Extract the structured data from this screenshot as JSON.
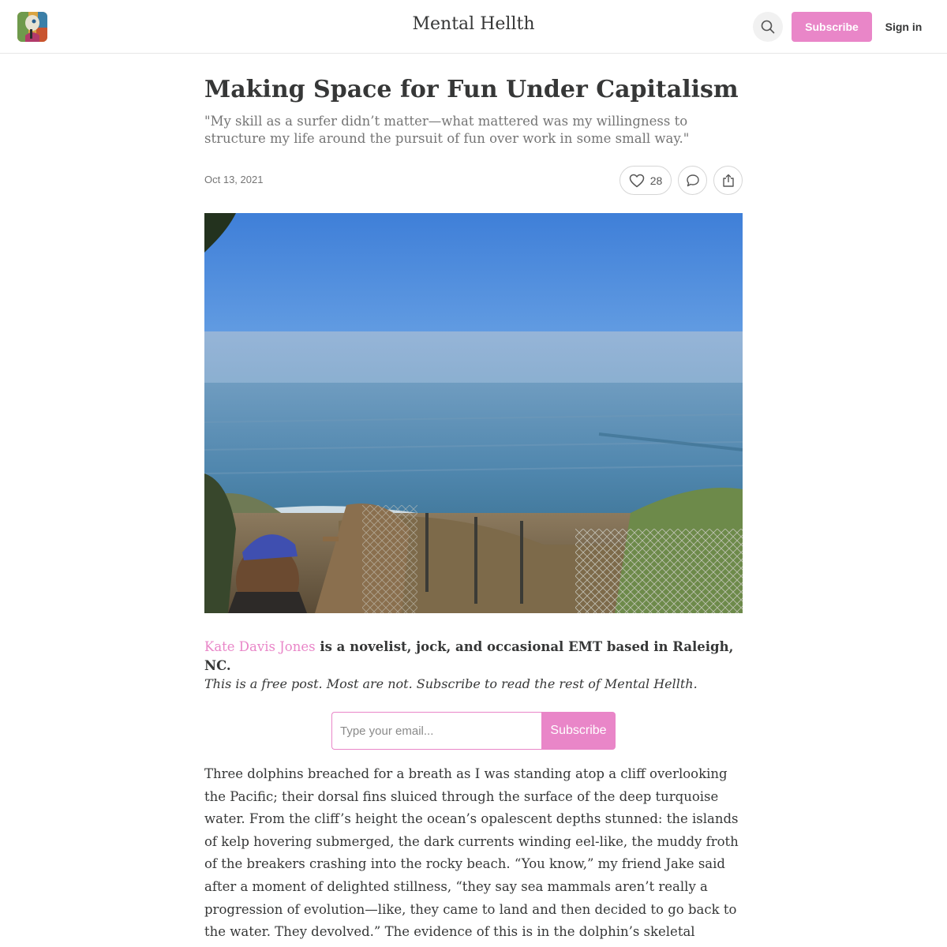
{
  "header": {
    "publication_title": "Mental Hellth",
    "subscribe_label": "Subscribe",
    "signin_label": "Sign in",
    "accent_color": "#e986c8"
  },
  "icons": {
    "logo": "publication-logo",
    "search": "search-icon",
    "like": "heart-icon",
    "comment": "comment-icon",
    "share": "share-icon"
  },
  "post": {
    "title": "Making Space for Fun Under Capitalism",
    "subtitle": "\"My skill as a surfer didn’t matter—what mattered was my willingness to structure my life around the pursuit of fun over work in some small way.\"",
    "date": "Oct 13, 2021",
    "like_count": "28",
    "byline_author": "Kate Davis Jones",
    "byline_rest": " is a novelist, jock, and occasional EMT based in Raleigh, NC.",
    "free_note": "This is a free post. Most are not. Subscribe to read the rest of Mental Hellth.",
    "body": "Three dolphins breached for a breath as I was standing atop a cliff overlooking the Pacific; their dorsal fins sluiced through the surface of the deep turquoise water. From the cliff’s height the ocean’s opalescent depths stunned: the islands of kelp hovering submerged, the dark currents winding eel-like, the muddy froth of the breakers crashing into the rocky beach. “You know,” my friend Jake said after a moment of delighted stillness, “they say sea mammals aren’t really a progression of evolution—like, they came to land and then decided to go back to the water. They devolved.” The evidence of this is in the dolphin’s skeletal structure, its pelvis that could in theory"
  },
  "subscribe_form": {
    "email_placeholder": "Type your email...",
    "email_value": "",
    "submit_label": "Subscribe"
  }
}
